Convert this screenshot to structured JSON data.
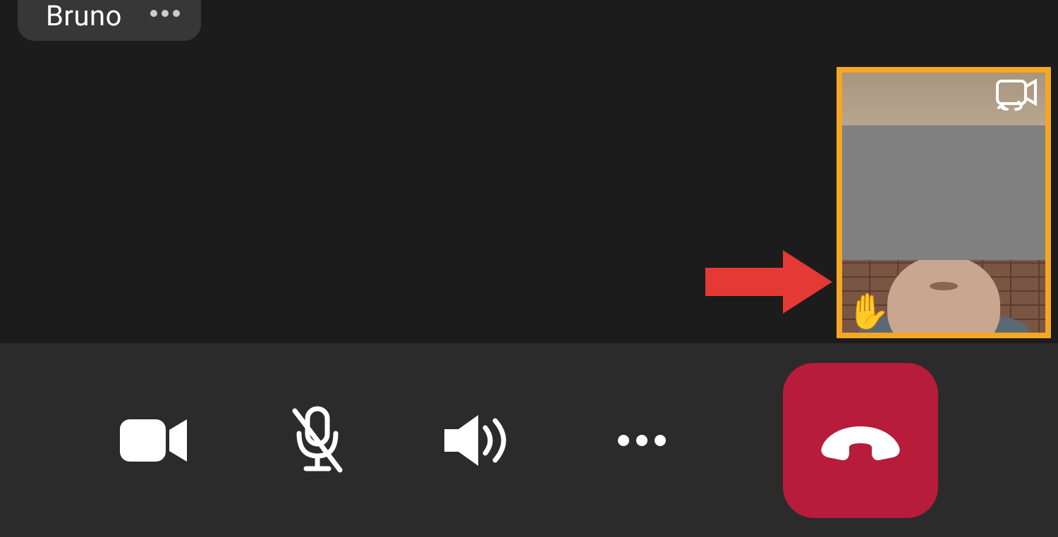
{
  "participant": {
    "name": "Bruno"
  },
  "self_preview": {
    "hand_raised_emoji": "✋",
    "border_color": "#f5a623"
  },
  "toolbar": {
    "camera": "camera",
    "mic_muted": "microphone-muted",
    "speaker": "speaker",
    "more": "more-options",
    "end_call": "end-call",
    "end_call_bg": "#b71c3a"
  },
  "annotation": {
    "arrow_color": "#e53935"
  }
}
